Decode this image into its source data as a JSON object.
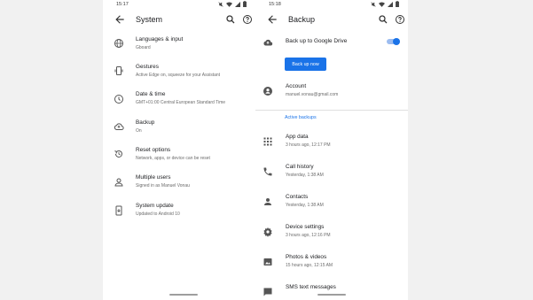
{
  "left": {
    "status_time": "15:17",
    "title": "System",
    "items": [
      {
        "title": "Languages & input",
        "subtitle": "Gboard",
        "icon": "globe-icon"
      },
      {
        "title": "Gestures",
        "subtitle": "Active Edge on, squeeze for your Assistant",
        "icon": "phone-gesture-icon"
      },
      {
        "title": "Date & time",
        "subtitle": "GMT+01:00 Central European Standard Time",
        "icon": "clock-icon"
      },
      {
        "title": "Backup",
        "subtitle": "On",
        "icon": "cloud-backup-icon"
      },
      {
        "title": "Reset options",
        "subtitle": "Network, apps, or device can be reset",
        "icon": "history-icon"
      },
      {
        "title": "Multiple users",
        "subtitle": "Signed in as Manuel Vonau",
        "icon": "person-icon"
      },
      {
        "title": "System update",
        "subtitle": "Updated to Android 10",
        "icon": "system-update-icon"
      }
    ]
  },
  "right": {
    "status_time": "15:18",
    "title": "Backup",
    "backup_toggle": {
      "label": "Back up to Google Drive",
      "on": true
    },
    "backup_now_label": "Back up now",
    "account": {
      "title": "Account",
      "value": "manuel.vonau@gmail.com"
    },
    "section_label": "Active backups",
    "items": [
      {
        "title": "App data",
        "subtitle": "3 hours ago, 12:17 PM",
        "icon": "apps-grid-icon"
      },
      {
        "title": "Call history",
        "subtitle": "Yesterday, 1:38 AM",
        "icon": "phone-icon"
      },
      {
        "title": "Contacts",
        "subtitle": "Yesterday, 1:38 AM",
        "icon": "person-icon"
      },
      {
        "title": "Device settings",
        "subtitle": "3 hours ago, 12:16 PM",
        "icon": "gear-icon"
      },
      {
        "title": "Photos & videos",
        "subtitle": "15 hours ago, 12:15 AM",
        "icon": "photo-icon"
      },
      {
        "title": "SMS text messages",
        "subtitle": "",
        "icon": "message-icon"
      }
    ]
  },
  "colors": {
    "accent": "#1a73e8",
    "text": "#202124",
    "secondary": "#6b6b6b"
  }
}
